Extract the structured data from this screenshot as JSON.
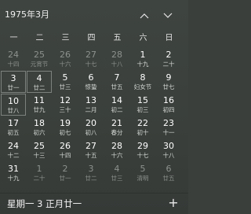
{
  "header": {
    "month_title": "1975年3月"
  },
  "weekdays": [
    "一",
    "二",
    "三",
    "四",
    "五",
    "六",
    "日"
  ],
  "weeks": [
    [
      {
        "day": "24",
        "lunar": "十四",
        "state": "dim"
      },
      {
        "day": "25",
        "lunar": "元宵节",
        "state": "dim"
      },
      {
        "day": "26",
        "lunar": "十六",
        "state": "dim"
      },
      {
        "day": "27",
        "lunar": "十七",
        "state": "dim"
      },
      {
        "day": "28",
        "lunar": "十八",
        "state": "dim"
      },
      {
        "day": "1",
        "lunar": "十九",
        "state": "cur"
      },
      {
        "day": "2",
        "lunar": "二十",
        "state": "cur"
      }
    ],
    [
      {
        "day": "3",
        "lunar": "廿一",
        "state": "cur",
        "boxed": true
      },
      {
        "day": "4",
        "lunar": "廿二",
        "state": "cur",
        "boxed": true
      },
      {
        "day": "5",
        "lunar": "廿三",
        "state": "cur"
      },
      {
        "day": "6",
        "lunar": "惊蛰",
        "state": "cur"
      },
      {
        "day": "7",
        "lunar": "廿五",
        "state": "cur"
      },
      {
        "day": "8",
        "lunar": "妇女节",
        "state": "cur"
      },
      {
        "day": "9",
        "lunar": "廿七",
        "state": "cur"
      }
    ],
    [
      {
        "day": "10",
        "lunar": "廿八",
        "state": "cur",
        "boxed": true
      },
      {
        "day": "11",
        "lunar": "廿九",
        "state": "cur"
      },
      {
        "day": "12",
        "lunar": "三十",
        "state": "cur"
      },
      {
        "day": "13",
        "lunar": "二月",
        "state": "cur"
      },
      {
        "day": "14",
        "lunar": "初二",
        "state": "cur"
      },
      {
        "day": "15",
        "lunar": "初三",
        "state": "cur"
      },
      {
        "day": "16",
        "lunar": "初四",
        "state": "cur"
      }
    ],
    [
      {
        "day": "17",
        "lunar": "初五",
        "state": "cur"
      },
      {
        "day": "18",
        "lunar": "初六",
        "state": "cur"
      },
      {
        "day": "19",
        "lunar": "初七",
        "state": "cur"
      },
      {
        "day": "20",
        "lunar": "初八",
        "state": "cur"
      },
      {
        "day": "21",
        "lunar": "春分",
        "state": "cur"
      },
      {
        "day": "22",
        "lunar": "初十",
        "state": "cur"
      },
      {
        "day": "23",
        "lunar": "十一",
        "state": "cur"
      }
    ],
    [
      {
        "day": "24",
        "lunar": "十二",
        "state": "cur"
      },
      {
        "day": "25",
        "lunar": "十三",
        "state": "cur"
      },
      {
        "day": "26",
        "lunar": "十四",
        "state": "cur"
      },
      {
        "day": "27",
        "lunar": "十五",
        "state": "cur"
      },
      {
        "day": "28",
        "lunar": "十六",
        "state": "cur"
      },
      {
        "day": "29",
        "lunar": "十七",
        "state": "cur"
      },
      {
        "day": "30",
        "lunar": "十八",
        "state": "cur"
      }
    ],
    [
      {
        "day": "31",
        "lunar": "十九",
        "state": "cur"
      },
      {
        "day": "1",
        "lunar": "二十",
        "state": "dim"
      },
      {
        "day": "2",
        "lunar": "廿一",
        "state": "dim"
      },
      {
        "day": "3",
        "lunar": "廿二",
        "state": "dim"
      },
      {
        "day": "4",
        "lunar": "廿三",
        "state": "dim"
      },
      {
        "day": "5",
        "lunar": "清明",
        "state": "dim"
      },
      {
        "day": "6",
        "lunar": "廿五",
        "state": "dim"
      }
    ]
  ],
  "footer": {
    "date_text": "星期一 3 正月廿一",
    "add_label": "+"
  },
  "icons": {
    "prev": "chevron-up-icon",
    "next": "chevron-down-icon"
  }
}
